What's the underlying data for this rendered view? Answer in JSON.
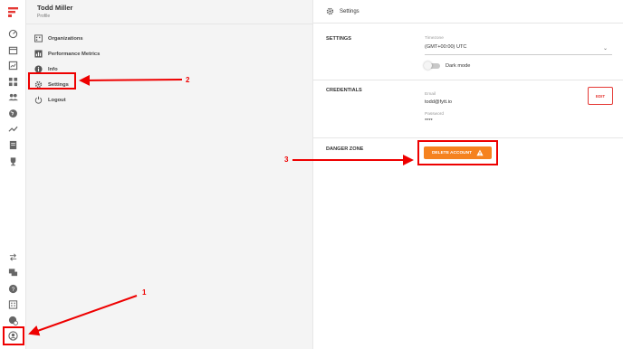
{
  "profile": {
    "name": "Todd Miller",
    "subtitle": "Profile"
  },
  "menu": [
    {
      "label": "Organizations",
      "icon": "organizations-icon"
    },
    {
      "label": "Performance Metrics",
      "icon": "bar-chart-icon"
    },
    {
      "label": "Info",
      "icon": "info-icon"
    },
    {
      "label": "Settings",
      "icon": "gear-icon"
    },
    {
      "label": "Logout",
      "icon": "power-icon"
    }
  ],
  "rail_icons_top": [
    "dashboard-icon",
    "calendar-icon",
    "chart-icon",
    "grid-icon",
    "people-icon",
    "globe-icon",
    "trending-icon",
    "document-icon",
    "trophy-icon"
  ],
  "rail_icons_bottom": [
    "swap-icon",
    "chat-icon",
    "help-icon",
    "building-icon",
    "settings-globe-icon",
    "profile-icon"
  ],
  "right": {
    "title": "Settings",
    "settings": {
      "heading": "SETTINGS",
      "timezone_label": "Timezone",
      "timezone_value": "(GMT+00:00) UTC",
      "dark_mode_label": "Dark mode"
    },
    "credentials": {
      "heading": "CREDENTIALS",
      "email_label": "Email",
      "email_value": "todd@fytt.io",
      "password_label": "Password",
      "password_value": "****",
      "edit_label": "EDIT"
    },
    "danger": {
      "heading": "DANGER ZONE",
      "delete_label": "DELETE ACCOUNT"
    }
  },
  "annotations": {
    "step1": "1",
    "step2": "2",
    "step3": "3"
  },
  "colors": {
    "brand": "#e53935",
    "accent_orange": "#f5821f",
    "annotation_red": "#e00000"
  }
}
